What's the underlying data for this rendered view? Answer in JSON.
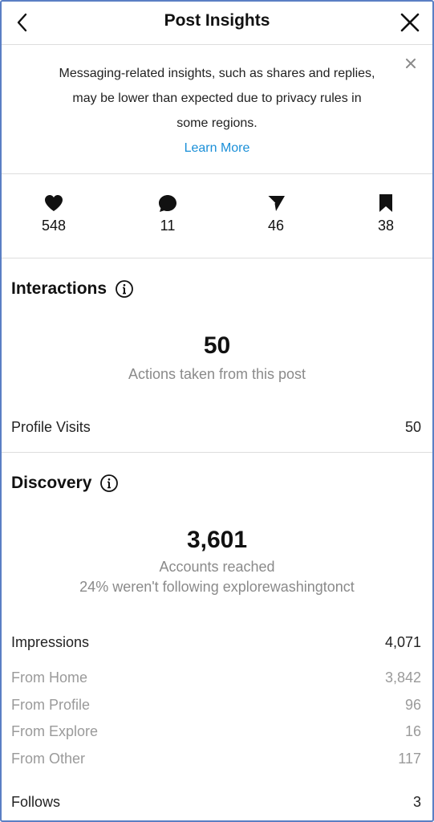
{
  "header": {
    "title": "Post Insights",
    "back_icon": "chevron-left-icon",
    "close_icon": "close-icon"
  },
  "notice": {
    "line1": "Messaging-related insights, such as shares and replies,",
    "line2": "may be lower than expected due to privacy rules in",
    "line3": "some regions.",
    "learn_more": "Learn More",
    "dismiss_icon": "close-small-icon"
  },
  "stats": [
    {
      "icon": "heart-icon",
      "value": "548"
    },
    {
      "icon": "comment-bubble-icon",
      "value": "11"
    },
    {
      "icon": "paper-plane-icon",
      "value": "46"
    },
    {
      "icon": "bookmark-icon",
      "value": "38"
    }
  ],
  "interactions": {
    "title": "Interactions",
    "info_icon": "info-icon",
    "total": "50",
    "subtitle": "Actions taken from this post",
    "rows": [
      {
        "label": "Profile Visits",
        "value": "50"
      }
    ]
  },
  "discovery": {
    "title": "Discovery",
    "info_icon": "info-icon",
    "total": "3,601",
    "subtitle": "Accounts reached",
    "subtitle2": "24% weren't following explorewashingtonct",
    "impressions": {
      "label": "Impressions",
      "value": "4,071"
    },
    "breakdown": [
      {
        "label": "From Home",
        "value": "3,842"
      },
      {
        "label": "From Profile",
        "value": "96"
      },
      {
        "label": "From Explore",
        "value": "16"
      },
      {
        "label": "From Other",
        "value": "117"
      }
    ],
    "follows": {
      "label": "Follows",
      "value": "3"
    }
  },
  "colors": {
    "link": "#1a8fd8",
    "secondary_text": "#8a8a8a",
    "divider": "#dddddd",
    "frame_border": "#5a7fc4"
  }
}
